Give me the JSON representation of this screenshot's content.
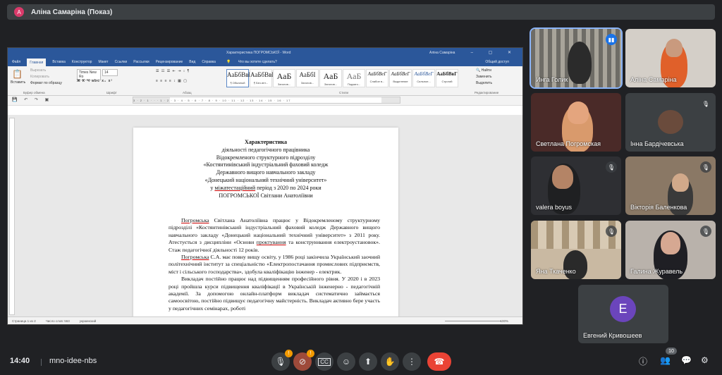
{
  "presenter": {
    "initial": "А",
    "title": "Аліна Самаріна (Показ)"
  },
  "word": {
    "window_title": "Характеристика ПОГРОМСЬКОЇ - Word",
    "user": "Аліна Самаріна",
    "tabs": [
      "Файл",
      "Главная",
      "Вставка",
      "Конструктор",
      "Макет",
      "Ссылки",
      "Рассылки",
      "Рецензирование",
      "Вид",
      "Справка"
    ],
    "tell_me": "Что вы хотите сделать?",
    "share": "Общий доступ",
    "clipboard": {
      "paste": "Вставить",
      "cut": "Вырезать",
      "copy": "Копировать",
      "format": "Формат по образцу",
      "group": "Буфер обмена"
    },
    "font": {
      "name": "Times New Ro",
      "size": "14",
      "group": "Шрифт",
      "tools": "Ж К Ч abc x₂ x²"
    },
    "paragraph_group": "Абзац",
    "styles_group": "Стили",
    "styles": [
      {
        "sample": "АаБбВвГ",
        "name": "¶ Обычный"
      },
      {
        "sample": "АаБбВвГ",
        "name": "¶ Без инт..."
      },
      {
        "sample": "АаБ",
        "name": "Заголов..."
      },
      {
        "sample": "АаБбІ",
        "name": "Заголов..."
      },
      {
        "sample": "АаБ",
        "name": "Заголов..."
      },
      {
        "sample": "АаБ",
        "name": "Подзаго..."
      },
      {
        "sample": "АаБбВеГ",
        "name": "Слабое в..."
      },
      {
        "sample": "АаБбВеГ",
        "name": "Выделение"
      },
      {
        "sample": "АаБбВеГ",
        "name": "Сильное..."
      },
      {
        "sample": "АаБбВвГ",
        "name": "Строгий"
      }
    ],
    "editing": {
      "find": "Найти",
      "replace": "Заменить",
      "select": "Выделить",
      "group": "Редактирование"
    },
    "ruler_numbers": "3 · 2 · 1 · · · 1 · 2 · 3 · 4 · 5 · 6 · 7 · 8 · 9 · 10 · 11 · 12 · 13 · 14 · 15 · 16 · 17",
    "status": {
      "page": "Страница 1 из 2",
      "words": "Число слов: 563",
      "lang": "украинский",
      "zoom": "100%"
    }
  },
  "document": {
    "title": "Характеристика",
    "header_lines": [
      "діяльності педагогічного працівника",
      "Відокремленого структурного підрозділу",
      "«Костянтинівський індустріальний фаховий коледж",
      "Державного вищого навчального закладу",
      "«Донецький національний технічний університет»"
    ],
    "period_pre": "у ",
    "period_underlined": "міжатестаційний",
    "period_post": " період з 2020 по 2024 роки",
    "person": "ПОГРОМСЬКОЇ Світлани Анатоліївни",
    "p1_underlined": "Погромська",
    "p1_text": " Світлана Анатоліївна працює у Відокремленому структурному підрозділі «Костянтинівський індустріальний фаховий коледж Державного вищого навчального закладу «Донецький національний технічний університет» з 2011 року. Атестується з дисципліни «Основи ",
    "p1_underlined2": "проктування",
    "p1_text2": " та конструювання електроустановок». Стаж педагогічної діяльності 12 років.",
    "p2_underlined": "Погромська",
    "p2_text": " С.А. має повну вищу освіту, у 1986 році закінчила Український заочний політехнічний інститут за спеціальністю «Електропостачання промислових підприємств, міст і сільського господарства», здобула кваліфікацію інженер - електрик.",
    "p3_text": "Викладач постійно працює над підвищенням професійного рівня. У 2020 і в 2023 році пройшла курси підвищення кваліфікації в Українській інженерно - педагогічній академії. За допомогою онлайн-платформ викладач систематично займається самоосвітою, постійно підвищує педагогічну майстерність. Викладач активно бере участь у педагогічних семінарах, роботі"
  },
  "participants": [
    {
      "name": "Инга Голик"
    },
    {
      "name": "Аліна Самаріна"
    },
    {
      "name": "Светлана Погромская"
    },
    {
      "name": "Інна Бардічевська"
    },
    {
      "name": "valera boyus"
    },
    {
      "name": "Вікторія Баленкова"
    },
    {
      "name": "Яна Ткаченко"
    },
    {
      "name": "Галина Журавель"
    },
    {
      "name": "Евгений Кривошеев",
      "initial": "E"
    }
  ],
  "bottom": {
    "time": "14:40",
    "meeting_code": "mno-idee-nbs",
    "mic_badge": "!",
    "cam_badge": "!",
    "participant_count": "10"
  },
  "colors": {
    "word_blue": "#2b579a",
    "hangup": "#ea4335",
    "avatar_e": "#6b45bc",
    "speaking": "#1a73e8"
  }
}
